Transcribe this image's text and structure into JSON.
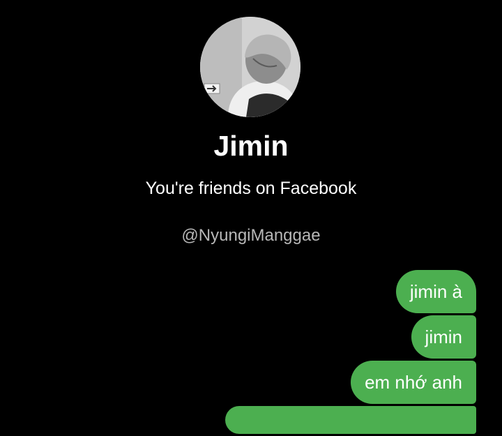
{
  "contact": {
    "name": "Jimin",
    "relationship": "You're friends on Facebook",
    "username": "@NyungiManggae"
  },
  "messages": [
    {
      "text": "jimin à",
      "sender": "self"
    },
    {
      "text": "jimin",
      "sender": "self"
    },
    {
      "text": "em nhớ anh",
      "sender": "self"
    }
  ],
  "colors": {
    "background": "#000000",
    "bubble": "#4caf50",
    "username": "#b7b7b7"
  }
}
